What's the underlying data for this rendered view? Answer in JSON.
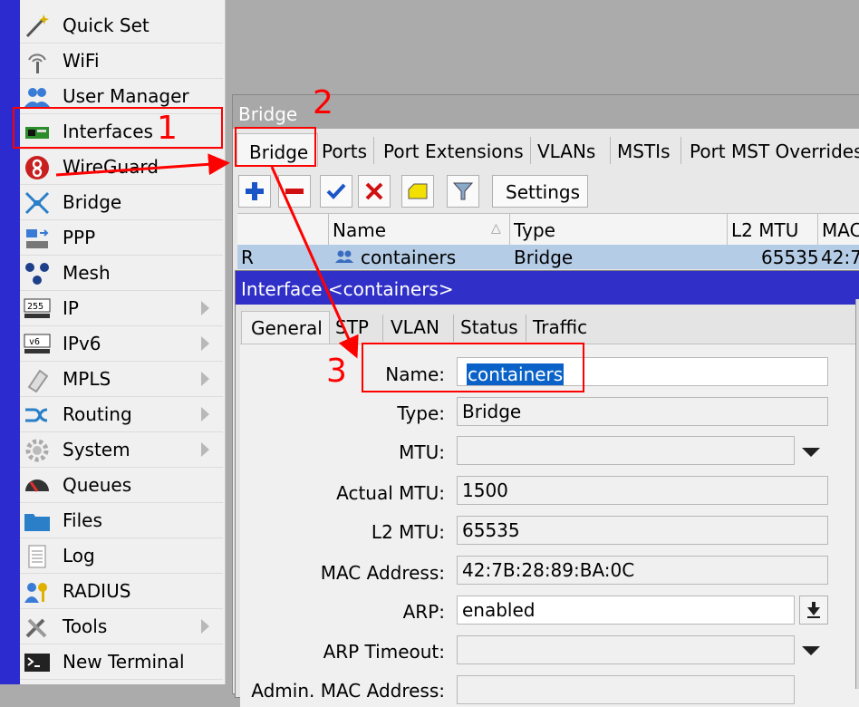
{
  "sidebar": {
    "items": [
      {
        "label": "Quick Set",
        "icon": "wand-icon",
        "submenu": false
      },
      {
        "label": "WiFi",
        "icon": "wifi-antenna-icon",
        "submenu": false
      },
      {
        "label": "User Manager",
        "icon": "users-icon",
        "submenu": false
      },
      {
        "label": "Interfaces",
        "icon": "network-card-icon",
        "submenu": false
      },
      {
        "label": "WireGuard",
        "icon": "wireguard-icon",
        "submenu": false
      },
      {
        "label": "Bridge",
        "icon": "bridge-icon",
        "submenu": false
      },
      {
        "label": "PPP",
        "icon": "ppp-icon",
        "submenu": false
      },
      {
        "label": "Mesh",
        "icon": "mesh-icon",
        "submenu": false
      },
      {
        "label": "IP",
        "icon": "ip-255-icon",
        "submenu": true
      },
      {
        "label": "IPv6",
        "icon": "ipv6-icon",
        "submenu": true
      },
      {
        "label": "MPLS",
        "icon": "mpls-icon",
        "submenu": true
      },
      {
        "label": "Routing",
        "icon": "routing-icon",
        "submenu": true
      },
      {
        "label": "System",
        "icon": "gear-icon",
        "submenu": true
      },
      {
        "label": "Queues",
        "icon": "gauge-icon",
        "submenu": false
      },
      {
        "label": "Files",
        "icon": "folder-icon",
        "submenu": false
      },
      {
        "label": "Log",
        "icon": "log-icon",
        "submenu": false
      },
      {
        "label": "RADIUS",
        "icon": "radius-icon",
        "submenu": false
      },
      {
        "label": "Tools",
        "icon": "tools-icon",
        "submenu": true
      },
      {
        "label": "New Terminal",
        "icon": "terminal-icon",
        "submenu": false
      }
    ]
  },
  "bridge_window": {
    "title": "Bridge",
    "tabs": [
      "Bridge",
      "Ports",
      "Port Extensions",
      "VLANs",
      "MSTIs",
      "Port MST Overrides"
    ],
    "toolbar": {
      "add": "add-icon",
      "remove": "remove-icon",
      "enable": "check-icon",
      "disable": "x-icon",
      "comment": "comment-icon",
      "filter": "filter-icon",
      "settings_label": "Settings"
    },
    "table": {
      "columns": [
        "",
        "Name",
        "Type",
        "L2 MTU",
        "MAC"
      ],
      "rows": [
        {
          "flag": "R",
          "name": "containers",
          "type": "Bridge",
          "l2mtu": "65535",
          "mac": "42:7"
        }
      ]
    }
  },
  "interface_dialog": {
    "title": "Interface <containers>",
    "tabs": [
      "General",
      "STP",
      "VLAN",
      "Status",
      "Traffic"
    ],
    "fields": {
      "name": {
        "label": "Name:",
        "value": "containers"
      },
      "type": {
        "label": "Type:",
        "value": "Bridge"
      },
      "mtu": {
        "label": "MTU:",
        "value": ""
      },
      "actual_mtu": {
        "label": "Actual MTU:",
        "value": "1500"
      },
      "l2_mtu": {
        "label": "L2 MTU:",
        "value": "65535"
      },
      "mac_address": {
        "label": "MAC Address:",
        "value": "42:7B:28:89:BA:0C"
      },
      "arp": {
        "label": "ARP:",
        "value": "enabled"
      },
      "arp_timeout": {
        "label": "ARP Timeout:",
        "value": ""
      },
      "admin_mac": {
        "label": "Admin. MAC Address:",
        "value": ""
      }
    }
  },
  "annotations": {
    "step1": "1",
    "step2": "2",
    "step3": "3",
    "color": "#ff0000"
  }
}
